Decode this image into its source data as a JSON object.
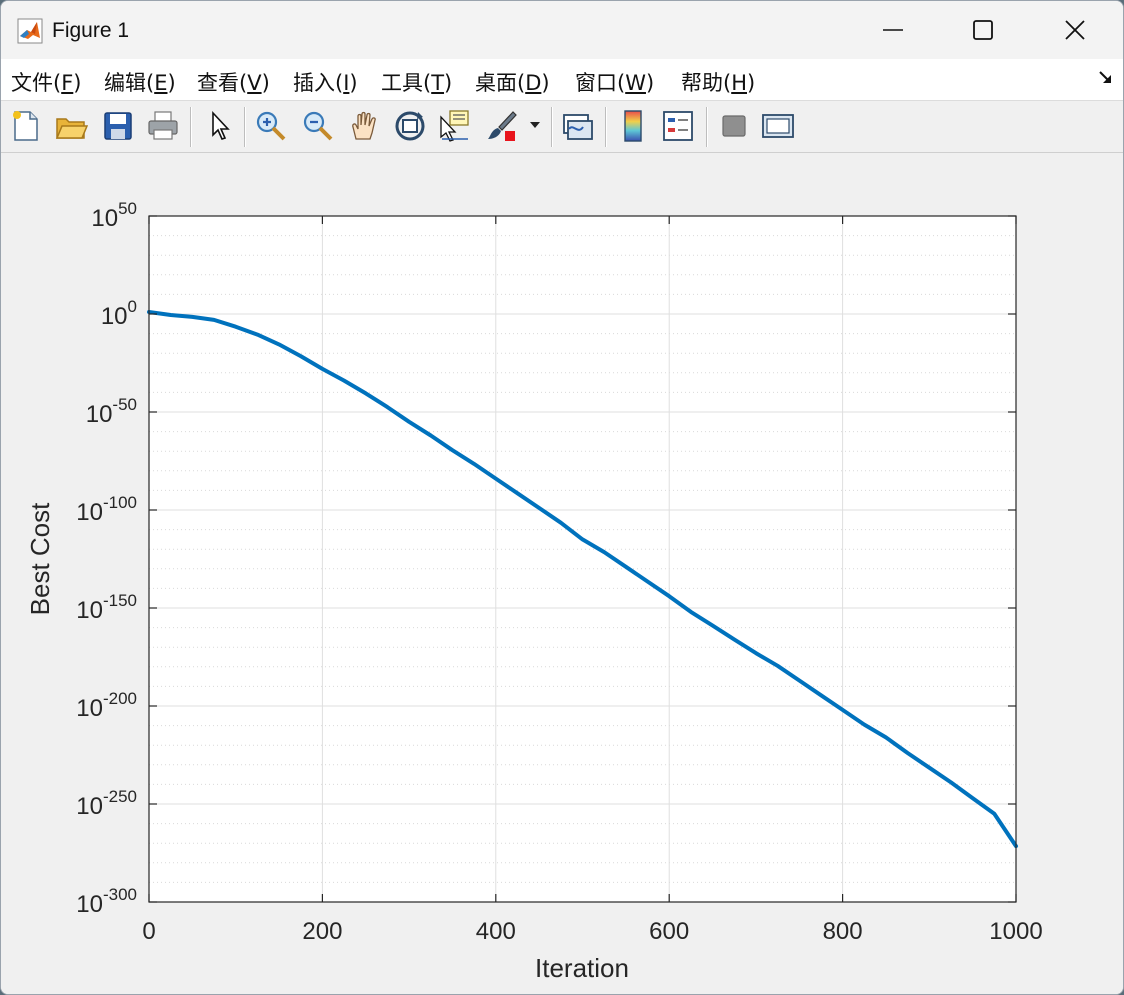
{
  "window": {
    "title": "Figure 1",
    "buttons": [
      "minimize",
      "maximize",
      "close"
    ]
  },
  "menubar": {
    "items": [
      {
        "pre": "文件(",
        "key": "F",
        "post": ")"
      },
      {
        "pre": "编辑(",
        "key": "E",
        "post": ")"
      },
      {
        "pre": "查看(",
        "key": "V",
        "post": ")"
      },
      {
        "pre": "插入(",
        "key": "I",
        "post": ")"
      },
      {
        "pre": "工具(",
        "key": "T",
        "post": ")"
      },
      {
        "pre": "桌面(",
        "key": "D",
        "post": ")"
      },
      {
        "pre": "窗口(",
        "key": "W",
        "post": ")"
      },
      {
        "pre": "帮助(",
        "key": "H",
        "post": ")"
      }
    ]
  },
  "toolbar": {
    "icons": [
      "new-figure-icon",
      "open-file-icon",
      "save-icon",
      "print-icon",
      "edit-plot-arrow-icon",
      "zoom-in-icon",
      "zoom-out-icon",
      "pan-hand-icon",
      "rotate-3d-icon",
      "data-cursor-icon",
      "brush-icon",
      "link-plot-icon",
      "colorbar-icon",
      "legend-icon",
      "hide-plot-tools-icon",
      "show-plot-tools-icon"
    ]
  },
  "colors": {
    "line": "#0072BD",
    "grid": "#dfdfdf",
    "axes_bg": "#ffffff"
  },
  "chart_data": {
    "type": "line",
    "xlabel": "Iteration",
    "ylabel": "Best Cost",
    "xlim": [
      0,
      1000
    ],
    "ylim_log10": [
      -300,
      50
    ],
    "yscale": "log",
    "grid": true,
    "minor_grid": true,
    "xticks": [
      0,
      200,
      400,
      600,
      800,
      1000
    ],
    "yticks": [
      {
        "base": "10",
        "exp": "50"
      },
      {
        "base": "10",
        "exp": "0"
      },
      {
        "base": "10",
        "exp": "-50"
      },
      {
        "base": "10",
        "exp": "-100"
      },
      {
        "base": "10",
        "exp": "-150"
      },
      {
        "base": "10",
        "exp": "-200"
      },
      {
        "base": "10",
        "exp": "-250"
      },
      {
        "base": "10",
        "exp": "-300"
      }
    ],
    "series": [
      {
        "x": [
          0,
          25,
          50,
          75,
          100,
          125,
          150,
          175,
          200,
          225,
          250,
          275,
          300,
          325,
          350,
          375,
          400,
          425,
          450,
          475,
          500,
          525,
          550,
          575,
          600,
          625,
          650,
          675,
          700,
          725,
          750,
          775,
          800,
          825,
          850,
          875,
          900,
          925,
          950,
          975,
          1000
        ],
        "log10_y": [
          1,
          -0.5,
          -1.5,
          -3,
          -6.5,
          -10.5,
          -15.5,
          -21.5,
          -28,
          -34,
          -40.5,
          -47.5,
          -55,
          -62,
          -69.5,
          -76.5,
          -84,
          -91.5,
          -99,
          -106.5,
          -115,
          -121.5,
          -129,
          -136.5,
          -144,
          -152,
          -159,
          -166,
          -173,
          -179.5,
          -187,
          -194.5,
          -202,
          -209.5,
          -216,
          -224,
          -231.5,
          -239,
          -247,
          -255,
          -271.5
        ]
      }
    ]
  }
}
